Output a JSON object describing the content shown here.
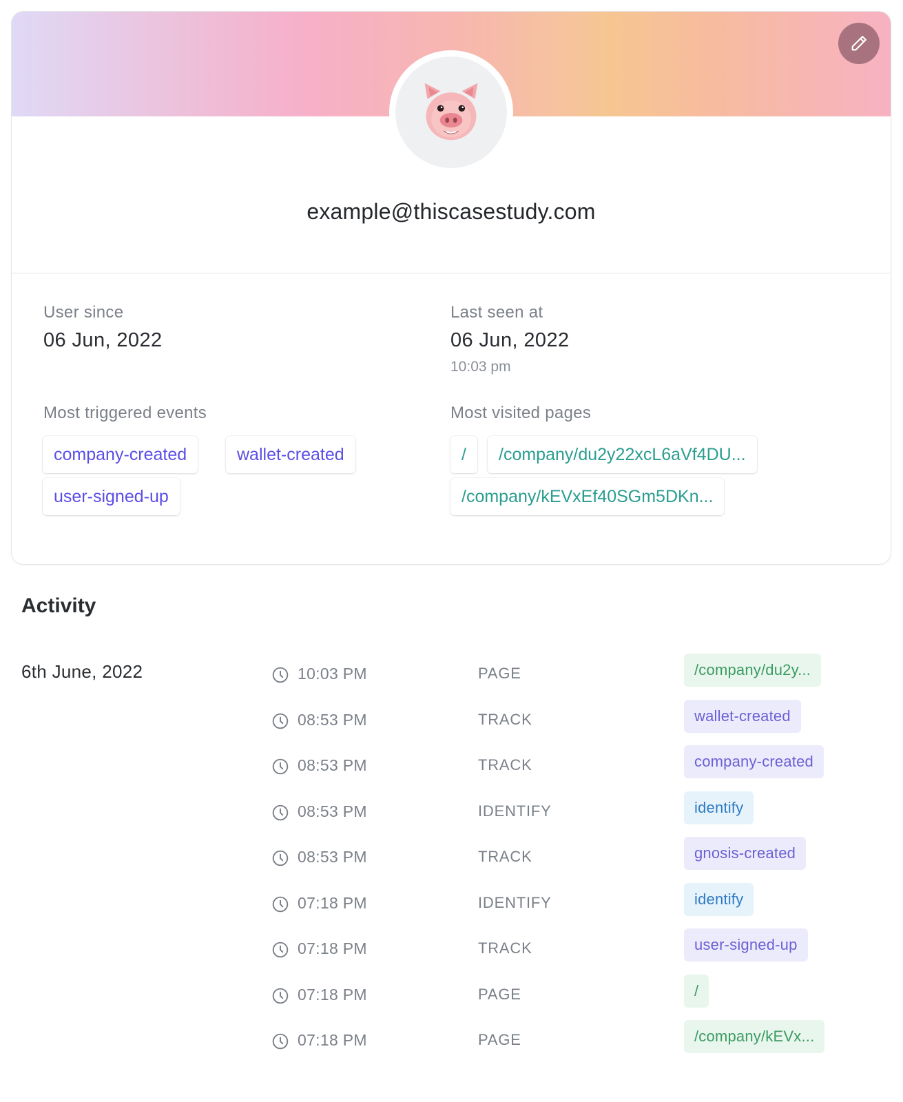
{
  "profile": {
    "email": "example@thiscasestudy.com",
    "avatar_emoji": "🐷",
    "edit_icon": "pencil-icon"
  },
  "stats": {
    "user_since_label": "User since",
    "user_since_value": "06 Jun, 2022",
    "last_seen_label": "Last seen at",
    "last_seen_date": "06 Jun, 2022",
    "last_seen_time": "10:03 pm",
    "events_label": "Most triggered events",
    "events": [
      "company-created",
      "wallet-created",
      "user-signed-up"
    ],
    "pages_label": "Most visited pages",
    "pages": [
      "/",
      "/company/du2y22xcL6aVf4DU...",
      "/company/kEVxEf40SGm5DKn..."
    ]
  },
  "activity": {
    "title": "Activity",
    "date": "6th June, 2022",
    "rows": [
      {
        "time": "10:03 PM",
        "type": "PAGE",
        "badge": "/company/du2y..."
      },
      {
        "time": "08:53 PM",
        "type": "TRACK",
        "badge": "wallet-created"
      },
      {
        "time": "08:53 PM",
        "type": "TRACK",
        "badge": "company-created"
      },
      {
        "time": "08:53 PM",
        "type": "IDENTIFY",
        "badge": "identify"
      },
      {
        "time": "08:53 PM",
        "type": "TRACK",
        "badge": "gnosis-created"
      },
      {
        "time": "07:18 PM",
        "type": "IDENTIFY",
        "badge": "identify"
      },
      {
        "time": "07:18 PM",
        "type": "TRACK",
        "badge": "user-signed-up"
      },
      {
        "time": "07:18 PM",
        "type": "PAGE",
        "badge": "/"
      },
      {
        "time": "07:18 PM",
        "type": "PAGE",
        "badge": "/company/kEVx..."
      }
    ]
  },
  "colors": {
    "event_text": "#5b4ee6",
    "page_text": "#2a9d8f",
    "page_badge_bg": "#e8f6ed",
    "track_badge_bg": "#ecebfb",
    "identify_badge_bg": "#e6f3fb"
  }
}
